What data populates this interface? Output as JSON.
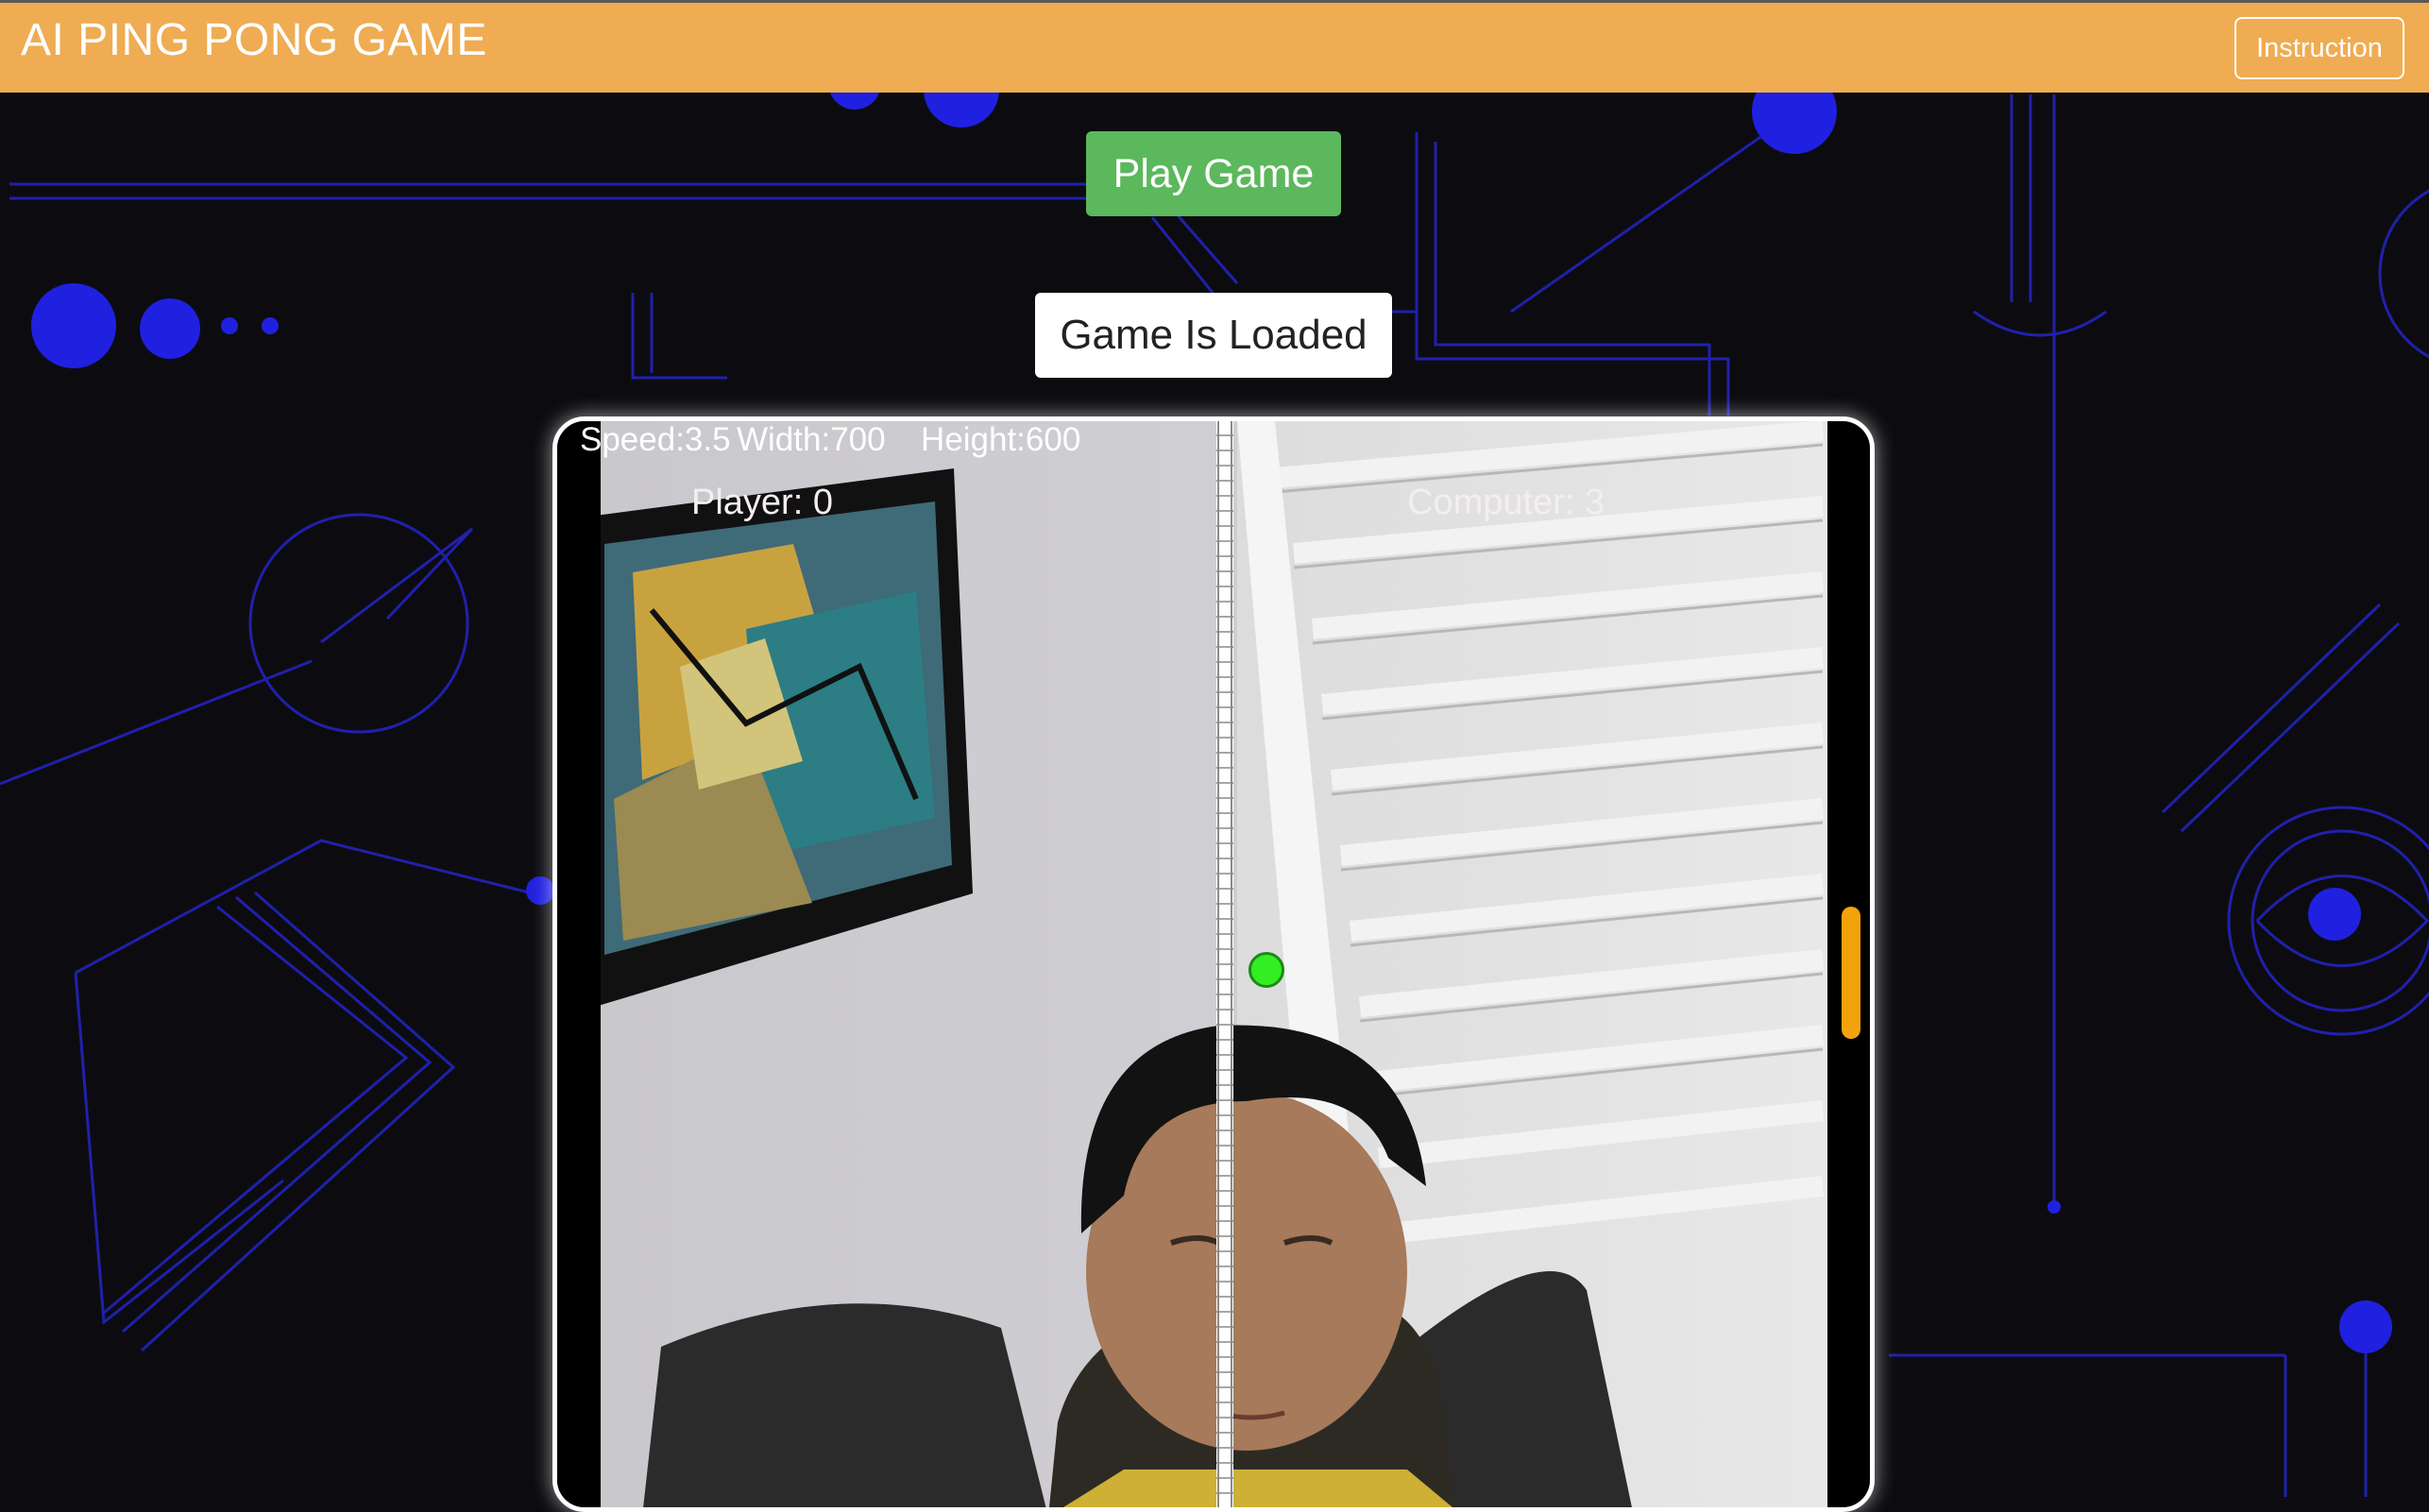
{
  "header": {
    "title": "AI PING PONG GAME",
    "instruction_label": "Instruction"
  },
  "controls": {
    "play_label": "Play Game",
    "status_text": "Game Is Loaded"
  },
  "game": {
    "speed_text": "Speed:3.5",
    "width_text": "Width:700",
    "height_text": "Height:600",
    "player_score_text": "Player: 0",
    "computer_score_text": "Computer: 3"
  },
  "colors": {
    "header_bg": "#efac52",
    "play_button": "#5cb85c",
    "ball": "#33ee22",
    "paddle": "#f2a30b",
    "background_lines": "#2222cc"
  }
}
